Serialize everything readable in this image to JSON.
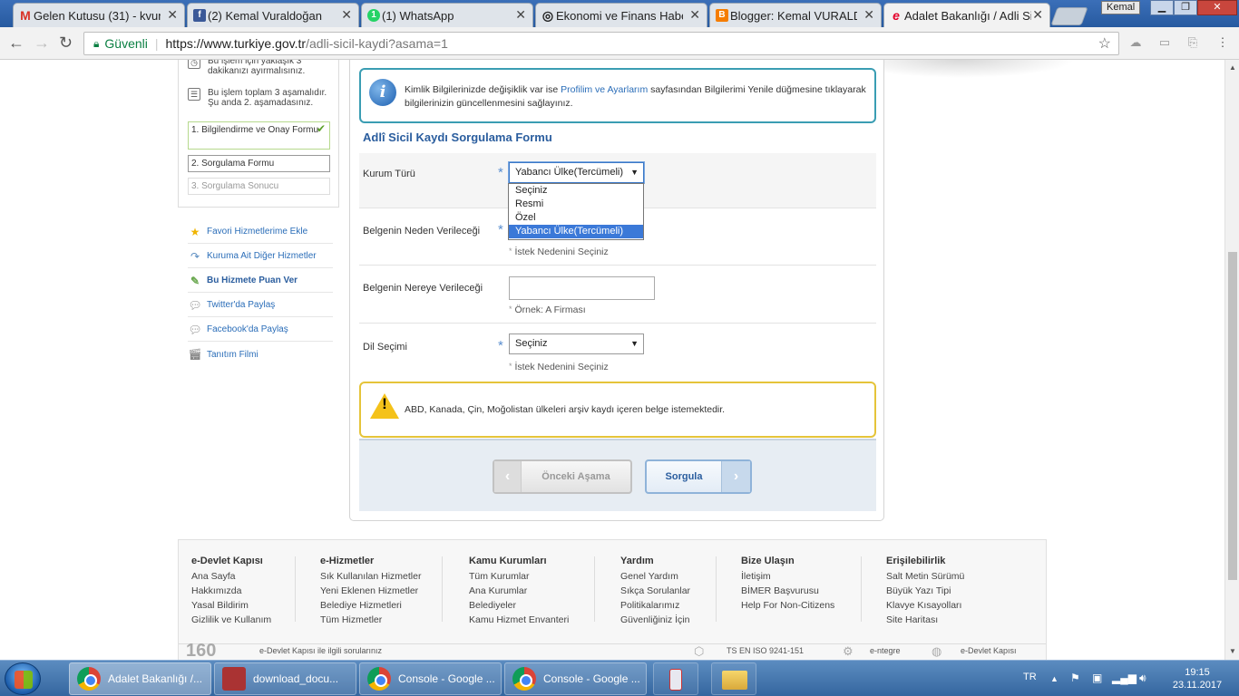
{
  "browser": {
    "tabs": [
      {
        "title": "Gelen Kutusu (31) - kvur",
        "icon": "gmail-icon",
        "color": "#d93025",
        "glyph": "M"
      },
      {
        "title": "(2) Kemal Vuraldoğan",
        "icon": "facebook-icon",
        "color": "#3b5998",
        "glyph": "f"
      },
      {
        "title": "(1) WhatsApp",
        "icon": "whatsapp-icon",
        "color": "#25d366",
        "glyph": "1"
      },
      {
        "title": "Ekonomi ve Finans Habe",
        "icon": "news-icon",
        "color": "#333333",
        "glyph": "◎"
      },
      {
        "title": "Blogger: Kemal VURALDİ",
        "icon": "blogger-icon",
        "color": "#f57d00",
        "glyph": "B"
      },
      {
        "title": "Adalet Bakanlığı / Adli Si",
        "icon": "edevlet-icon",
        "color": "#e4002b",
        "glyph": "e"
      }
    ],
    "active_tab": 5,
    "user": "Kemal",
    "secure_label": "Güvenli",
    "url_host": "https://www.turkiye.gov.tr",
    "url_path": "/adli-sicil-kaydi?asama=1"
  },
  "sidebar": {
    "info1": "Bu işlem için yaklaşık 3 dakikanızı ayırmalısınız.",
    "info2": "Bu işlem toplam 3 aşamalıdır. Şu anda 2. aşamadasınız.",
    "steps": [
      "1. Bilgilendirme ve Onay Formu",
      "2. Sorgulama Formu",
      "3. Sorgulama Sonucu"
    ],
    "links": [
      {
        "label": "Favori Hizmetlerime Ekle",
        "icon": "star-icon"
      },
      {
        "label": "Kuruma Ait Diğer Hizmetler",
        "icon": "arrow-icon"
      },
      {
        "label": "Bu Hizmete Puan Ver",
        "icon": "rate-icon"
      },
      {
        "label": "Twitter'da Paylaş",
        "icon": "twitter-icon"
      },
      {
        "label": "Facebook'da Paylaş",
        "icon": "facebook-icon"
      },
      {
        "label": "Tanıtım Filmi",
        "icon": "film-icon"
      }
    ]
  },
  "info": {
    "text1": "Kimlik Bilgilerinizde değişiklik var ise ",
    "link": "Profilim ve Ayarlarım",
    "text2": " sayfasından Bilgilerimi Yenile düğmesine tıklayarak bilgilerinizin güncellenmesini sağlayınız."
  },
  "form": {
    "title": "Adlî Sicil Kaydı Sorgulama Formu",
    "kurum_label": "Kurum Türü",
    "kurum_value": "Yabancı Ülke(Tercümeli)",
    "kurum_options": [
      "Seçiniz",
      "Resmi",
      "Özel",
      "Yabancı Ülke(Tercümeli)"
    ],
    "neden_label": "Belgenin Neden Verileceği",
    "neden_hint": "İstek Nedenini Seçiniz",
    "nereye_label": "Belgenin Nereye Verileceği",
    "nereye_value": "",
    "nereye_hint": "Örnek: A Firması",
    "dil_label": "Dil Seçimi",
    "dil_value": "Seçiniz",
    "dil_hint": "İstek Nedenini Seçiniz",
    "required_mark": "*"
  },
  "warning": "ABD, Kanada, Çin, Moğolistan ülkeleri arşiv kaydı içeren belge istemektedir.",
  "buttons": {
    "prev": "Önceki Aşama",
    "next": "Sorgula"
  },
  "footer": {
    "columns": [
      {
        "title": "e-Devlet Kapısı",
        "items": [
          "Ana Sayfa",
          "Hakkımızda",
          "Yasal Bildirim",
          "Gizlilik ve Kullanım"
        ]
      },
      {
        "title": "e-Hizmetler",
        "items": [
          "Sık Kullanılan Hizmetler",
          "Yeni Eklenen Hizmetler",
          "Belediye Hizmetleri",
          "Tüm Hizmetler"
        ]
      },
      {
        "title": "Kamu Kurumları",
        "items": [
          "Tüm Kurumlar",
          "Ana Kurumlar",
          "Belediyeler",
          "Kamu Hizmet Envanteri"
        ]
      },
      {
        "title": "Yardım",
        "items": [
          "Genel Yardım",
          "Sıkça Sorulanlar",
          "Politikalarımız",
          "Güvenliğiniz İçin"
        ]
      },
      {
        "title": "Bize Ulaşın",
        "items": [
          "İletişim",
          "BİMER Başvurusu",
          "Help For Non-Citizens"
        ]
      },
      {
        "title": "Erişilebilirlik",
        "items": [
          "Salt Metin Sürümü",
          "Büyük Yazı Tipi",
          "Klavye Kısayolları",
          "Site Haritası"
        ]
      }
    ],
    "call_number": "160",
    "call_text": "e-Devlet Kapısı ile ilgili sorularınız",
    "iso": "TS EN ISO 9241-151",
    "entegre": "e-ntegre",
    "ipv6": "e-Devlet Kapısı"
  },
  "taskbar": {
    "tasks": [
      "Adalet Bakanlığı /...",
      "download_docu...",
      "Console - Google ...",
      "Console - Google ..."
    ],
    "lang": "TR",
    "time": "19:15",
    "date": "23.11.2017"
  }
}
